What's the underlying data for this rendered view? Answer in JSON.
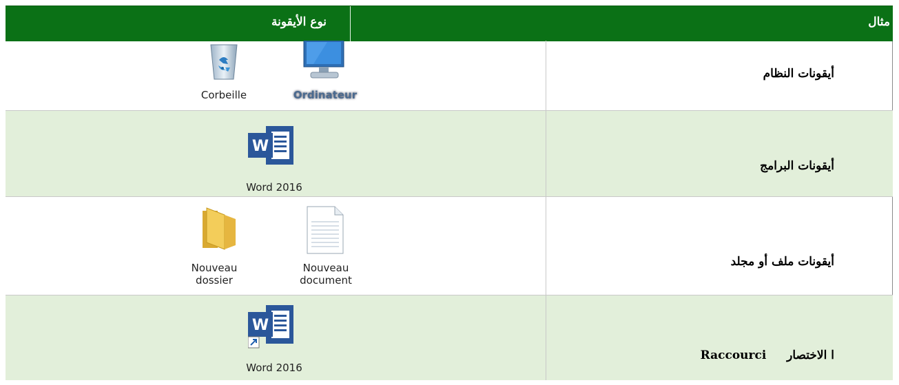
{
  "header": {
    "col_type": "نوع الأيقونة",
    "col_example": "مثال"
  },
  "rows": [
    {
      "label": "أيقونات النظام",
      "icons": [
        "Corbeille",
        "Ordinateur"
      ]
    },
    {
      "label": "أيقونات البرامج",
      "icons": [
        "Word 2016"
      ]
    },
    {
      "label": "أيقونات ملف أو مجلد",
      "icons": [
        "Nouveau dossier",
        "Nouveau document"
      ],
      "icon_lines": [
        [
          "Nouveau",
          "dossier"
        ],
        [
          "Nouveau",
          "document"
        ]
      ]
    },
    {
      "label_ar": "ا الاختصار",
      "label_fr": "Raccourci",
      "icons": [
        "Word 2016"
      ]
    }
  ],
  "colors": {
    "header_bg": "#0b7116",
    "row_alt_bg": "#e2efda",
    "word_blue": "#2b579a"
  }
}
